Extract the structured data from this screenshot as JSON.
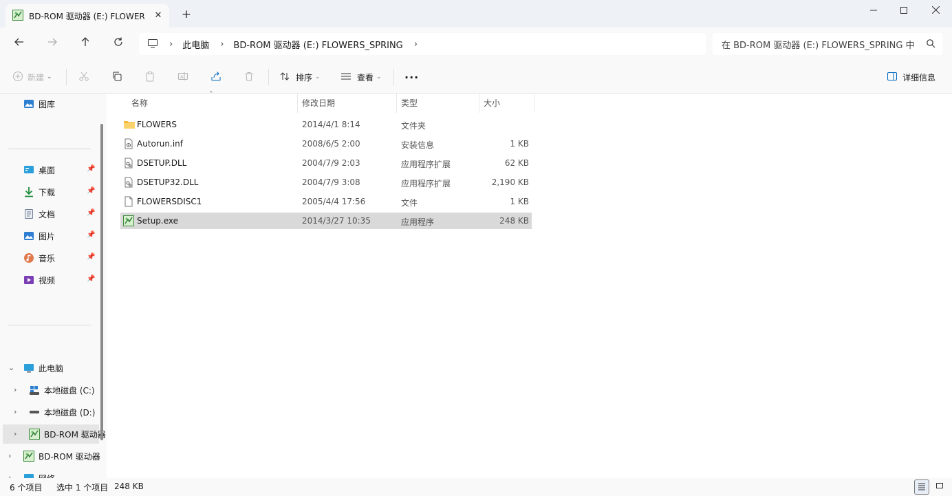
{
  "window": {
    "tab_title": "BD-ROM 驱动器 (E:) FLOWERS",
    "tab_icon": "disc-setup-icon",
    "new_tab": "+",
    "minimize": "—",
    "maximize": "☐",
    "close": "✕"
  },
  "address": {
    "crumbs": [
      "此电脑",
      "BD-ROM 驱动器 (E:) FLOWERS_SPRING"
    ],
    "search_placeholder": "在 BD-ROM 驱动器 (E:) FLOWERS_SPRING 中搜索"
  },
  "toolbar": {
    "new_label": "新建",
    "sort_label": "排序",
    "view_label": "查看",
    "more_label": "···",
    "details_label": "详细信息"
  },
  "sidebar": {
    "top_item": "图库",
    "quick_access": [
      {
        "label": "桌面",
        "icon": "desktop-icon"
      },
      {
        "label": "下载",
        "icon": "download-icon"
      },
      {
        "label": "文档",
        "icon": "document-icon"
      },
      {
        "label": "图片",
        "icon": "pictures-icon"
      },
      {
        "label": "音乐",
        "icon": "music-icon"
      },
      {
        "label": "视频",
        "icon": "video-icon"
      }
    ],
    "this_pc": "此电脑",
    "drives": [
      {
        "label": "本地磁盘 (C:)",
        "icon": "windows-drive-icon"
      },
      {
        "label": "本地磁盘 (D:)",
        "icon": "drive-icon"
      },
      {
        "label": "BD-ROM 驱动器",
        "icon": "disc-setup-icon"
      }
    ],
    "bd_rom_root": "BD-ROM 驱动器",
    "network": "网络"
  },
  "columns": {
    "name": "名称",
    "date": "修改日期",
    "type": "类型",
    "size": "大小"
  },
  "files": [
    {
      "name": "FLOWERS",
      "date": "2014/4/1 8:14",
      "type": "文件夹",
      "size": "",
      "icon": "folder-icon"
    },
    {
      "name": "Autorun.inf",
      "date": "2008/6/5 2:00",
      "type": "安装信息",
      "size": "1 KB",
      "icon": "settings-file-icon"
    },
    {
      "name": "DSETUP.DLL",
      "date": "2004/7/9 2:03",
      "type": "应用程序扩展",
      "size": "62 KB",
      "icon": "dll-file-icon"
    },
    {
      "name": "DSETUP32.DLL",
      "date": "2004/7/9 3:08",
      "type": "应用程序扩展",
      "size": "2,190 KB",
      "icon": "dll-file-icon"
    },
    {
      "name": "FLOWERSDISC1",
      "date": "2005/4/4 17:56",
      "type": "文件",
      "size": "1 KB",
      "icon": "blank-file-icon"
    },
    {
      "name": "Setup.exe",
      "date": "2014/3/27 10:35",
      "type": "应用程序",
      "size": "248 KB",
      "icon": "setup-exe-icon"
    }
  ],
  "status": {
    "count": "6 个项目",
    "selected": "选中 1 个项目",
    "selected_size": "248 KB"
  },
  "colors": {
    "accent": "#0067c0",
    "chrome": "#f9f9f9",
    "selection": "#d9d9d9"
  }
}
